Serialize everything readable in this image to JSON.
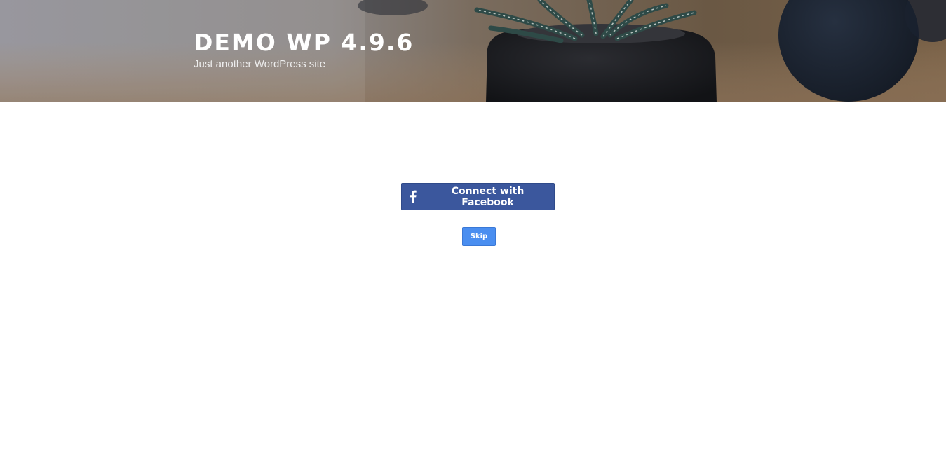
{
  "header": {
    "site_title": "DEMO WP 4.9.6",
    "site_description": "Just another WordPress site"
  },
  "login": {
    "facebook_button_label": "Connect with Facebook",
    "facebook_icon": "facebook-f-icon",
    "facebook_color": "#3b579d",
    "skip_button_label": "Skip",
    "skip_color": "#4a8ef0"
  }
}
